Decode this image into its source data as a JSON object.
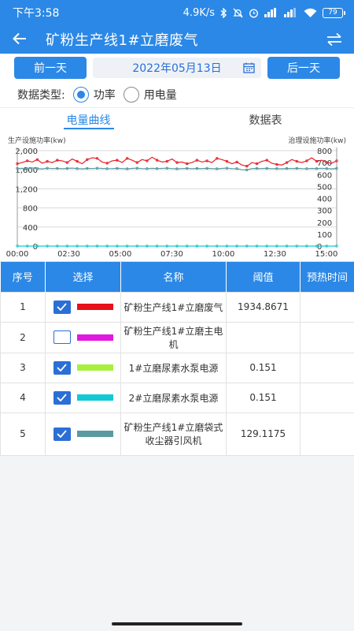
{
  "status": {
    "time": "下午3:58",
    "speed": "4.9K/s",
    "battery": "79"
  },
  "appbar": {
    "title": "矿粉生产线1#立磨废气",
    "back_icon": "arrow-left-icon",
    "swap_icon": "swap-arrows-icon"
  },
  "datebar": {
    "prev_label": "前一天",
    "date": "2022年05月13日",
    "next_label": "后一天"
  },
  "data_type": {
    "label": "数据类型:",
    "options": [
      "功率",
      "用电量"
    ],
    "selected": "功率"
  },
  "tabs": [
    "电量曲线",
    "数据表"
  ],
  "chart_data": {
    "type": "line",
    "y_left_label": "生产设施功率(kw)",
    "y_right_label": "治理设施功率(kw)",
    "y_left_ticks": [
      "0",
      "400",
      "800",
      "1,200",
      "1,600",
      "2,000"
    ],
    "y_left_range": [
      0,
      2000
    ],
    "y_right_ticks": [
      "0",
      "100",
      "200",
      "300",
      "400",
      "500",
      "600",
      "700",
      "800"
    ],
    "y_right_range": [
      0,
      800
    ],
    "x_ticks": [
      "00:00",
      "02:30",
      "05:00",
      "07:30",
      "10:00",
      "12:30",
      "15:00"
    ],
    "x_range_hours": [
      0,
      15.5
    ],
    "series": [
      {
        "color": "#e8202a",
        "axis": "right",
        "values": [
          690,
          700,
          715,
          705,
          725,
          695,
          710,
          700,
          720,
          715,
          700,
          730,
          710,
          690,
          725,
          740,
          735,
          705,
          695,
          715,
          720,
          700,
          735,
          720,
          700,
          725,
          715,
          745,
          720,
          705,
          710,
          730,
          700,
          705,
          690,
          700,
          720,
          705,
          715,
          700,
          735,
          725,
          710,
          690,
          705,
          680,
          670,
          700,
          690,
          710,
          720,
          695,
          685,
          680,
          700,
          725,
          710,
          700,
          715,
          740,
          710,
          720,
          700,
          695,
          715
        ]
      },
      {
        "color": "#13c9d4",
        "axis": "right",
        "values": [
          0,
          0,
          0,
          0,
          0,
          0,
          0,
          0,
          0,
          0,
          0,
          0,
          0,
          0,
          0,
          0,
          0,
          0,
          0,
          0,
          0,
          0,
          0,
          0,
          0,
          0,
          0,
          0,
          0,
          0,
          0,
          0,
          0,
          0,
          0,
          0,
          0,
          0,
          0,
          0,
          0,
          0,
          0,
          0,
          0,
          0,
          0,
          0,
          0,
          0,
          0,
          0,
          0,
          0,
          0,
          0,
          0,
          0,
          0,
          0,
          0,
          0,
          0,
          0,
          0
        ]
      },
      {
        "color": "#5a9aa0",
        "axis": "right",
        "values": [
          650,
          652,
          648,
          655,
          650,
          647,
          653,
          650,
          652,
          649,
          651,
          654,
          650,
          648,
          652,
          650,
          653,
          651,
          649,
          650,
          652,
          650,
          648,
          651,
          653,
          650,
          649,
          652,
          650,
          651,
          653,
          650,
          648,
          650,
          652,
          649,
          651,
          650,
          652,
          650,
          648,
          651,
          653,
          650,
          649,
          640,
          638,
          650,
          651,
          650,
          652,
          649,
          650,
          648,
          651,
          650,
          652,
          650,
          649,
          651,
          650,
          652,
          650,
          648,
          651
        ]
      }
    ]
  },
  "table": {
    "headers": [
      "序号",
      "选择",
      "名称",
      "阈值",
      "预热时间"
    ],
    "rows": [
      {
        "no": "1",
        "checked": true,
        "color": "#e8101a",
        "name": "矿粉生产线1#立磨废气",
        "threshold": "1934.8671",
        "preheat": ""
      },
      {
        "no": "2",
        "checked": false,
        "color": "#e018e0",
        "name": "矿粉生产线1#立磨主电机",
        "threshold": "",
        "preheat": ""
      },
      {
        "no": "3",
        "checked": true,
        "color": "#a8f040",
        "name": "1#立磨尿素水泵电源",
        "threshold": "0.151",
        "preheat": ""
      },
      {
        "no": "4",
        "checked": true,
        "color": "#13c9d4",
        "name": "2#立磨尿素水泵电源",
        "threshold": "0.151",
        "preheat": ""
      },
      {
        "no": "5",
        "checked": true,
        "color": "#5a9aa0",
        "name": "矿粉生产线1#立磨袋式收尘器引风机",
        "threshold": "129.1175",
        "preheat": ""
      }
    ]
  }
}
